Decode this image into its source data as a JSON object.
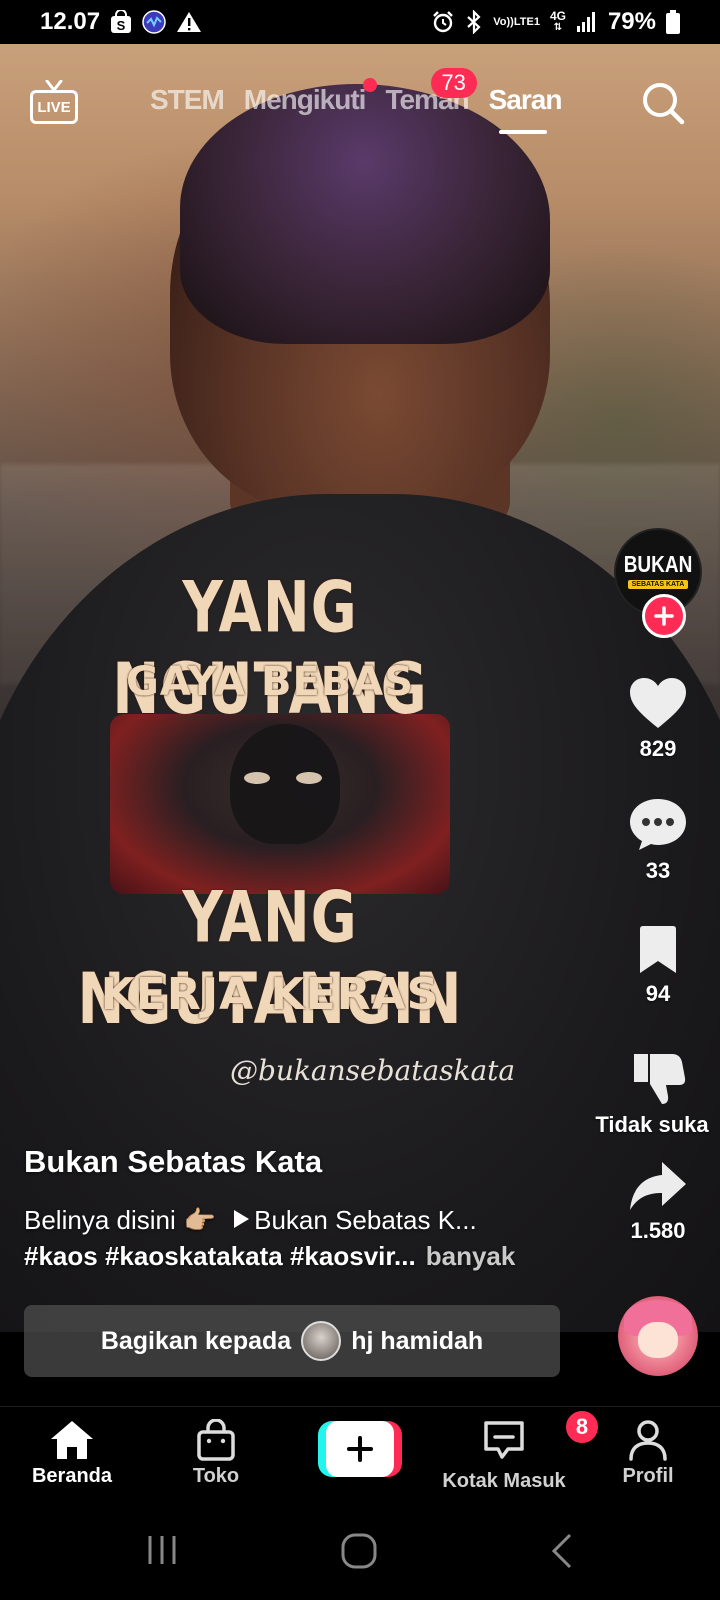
{
  "status_bar": {
    "time": "12.07",
    "signal_label_top": "Vo))",
    "signal_label_bottom": "LTE1",
    "network": "4G",
    "battery": "79%"
  },
  "top_nav": {
    "live_label": "LIVE",
    "tabs": [
      {
        "label": "STEM",
        "active": false
      },
      {
        "label": "Mengikuti",
        "active": false,
        "has_dot": true
      },
      {
        "label": "Teman",
        "active": false,
        "badge": "73"
      },
      {
        "label": "Saran",
        "active": true
      }
    ]
  },
  "video_print": {
    "line1": "YANG NGUTANG",
    "line2": "GAYA BEBAS",
    "line3": "YANG NGUTANGIN",
    "line4": "KERJA KERAS",
    "watermark": "@bukansebataskata"
  },
  "creator_avatar": {
    "logo_main": "BUKAN",
    "logo_sub": "SEBATAS KATA"
  },
  "actions": {
    "likes": "829",
    "comments": "33",
    "saves": "94",
    "dislike_label": "Tidak suka",
    "shares": "1.580"
  },
  "caption": {
    "creator_name": "Bukan Sebatas Kata",
    "desc_prefix": "Belinya disini",
    "desc_emoji": "👉🏼",
    "product_link": "Bukan Sebatas K...",
    "hashtags": "#kaos #kaoskatakata #kaosvir...",
    "more_label": "banyak"
  },
  "share_bar": {
    "prefix": "Bagikan kepada",
    "contact_name": "hj hamidah"
  },
  "bottom_nav": {
    "home_label": "Beranda",
    "shop_label": "Toko",
    "inbox_label": "Kotak Masuk",
    "inbox_badge": "8",
    "profile_label": "Profil"
  },
  "colors": {
    "accent": "#fe2c55",
    "create_cyan": "#25f4ee"
  }
}
